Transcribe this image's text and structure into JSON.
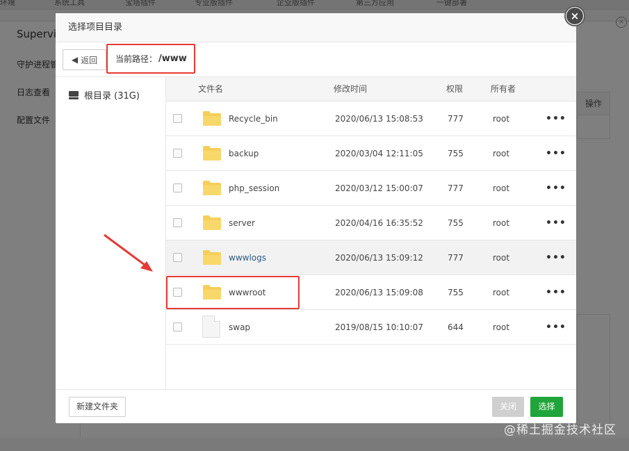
{
  "background": {
    "top_tabs": [
      "环境",
      "系统工具",
      "宝塔插件",
      "专业版插件",
      "企业版插件",
      "第三方应用",
      "一键部署"
    ],
    "panel_title": "Supervis",
    "side_items": [
      "守护进程管",
      "日志查看",
      "配置文件"
    ],
    "op_header": "操作"
  },
  "modal": {
    "title": "选择项目目录",
    "close_glyph": "×",
    "back_label": "返回",
    "path_label": "当前路径：",
    "path_value": "/www",
    "sidebar": {
      "root_label": "根目录 (31G)"
    },
    "columns": {
      "name": "文件名",
      "mtime": "修改时间",
      "perm": "权限",
      "owner": "所有者"
    },
    "rows": [
      {
        "type": "folder",
        "name": "Recycle_bin",
        "mtime": "2020/06/13 15:08:53",
        "perm": "777",
        "owner": "root",
        "more": "•••"
      },
      {
        "type": "folder",
        "name": "backup",
        "mtime": "2020/03/04 12:11:05",
        "perm": "755",
        "owner": "root",
        "more": "•••"
      },
      {
        "type": "folder",
        "name": "php_session",
        "mtime": "2020/03/12 15:00:07",
        "perm": "777",
        "owner": "root",
        "more": "•••"
      },
      {
        "type": "folder",
        "name": "server",
        "mtime": "2020/04/16 16:35:52",
        "perm": "755",
        "owner": "root",
        "more": "•••"
      },
      {
        "type": "folder",
        "name": "wwwlogs",
        "mtime": "2020/06/13 15:09:12",
        "perm": "777",
        "owner": "root",
        "more": "•••"
      },
      {
        "type": "folder",
        "name": "wwwroot",
        "mtime": "2020/06/13 15:09:08",
        "perm": "755",
        "owner": "root",
        "more": "•••"
      },
      {
        "type": "file",
        "name": "swap",
        "mtime": "2019/08/15 10:10:07",
        "perm": "644",
        "owner": "root",
        "more": "•••"
      }
    ],
    "footer": {
      "new_folder": "新建文件夹",
      "close": "关闭",
      "select": "选择"
    }
  },
  "watermark": "@稀土掘金技术社区",
  "colors": {
    "accent_green": "#20a53a",
    "highlight_red": "#e53935",
    "folder_yellow": "#f5cf5b",
    "link_blue": "#2c5a85"
  }
}
